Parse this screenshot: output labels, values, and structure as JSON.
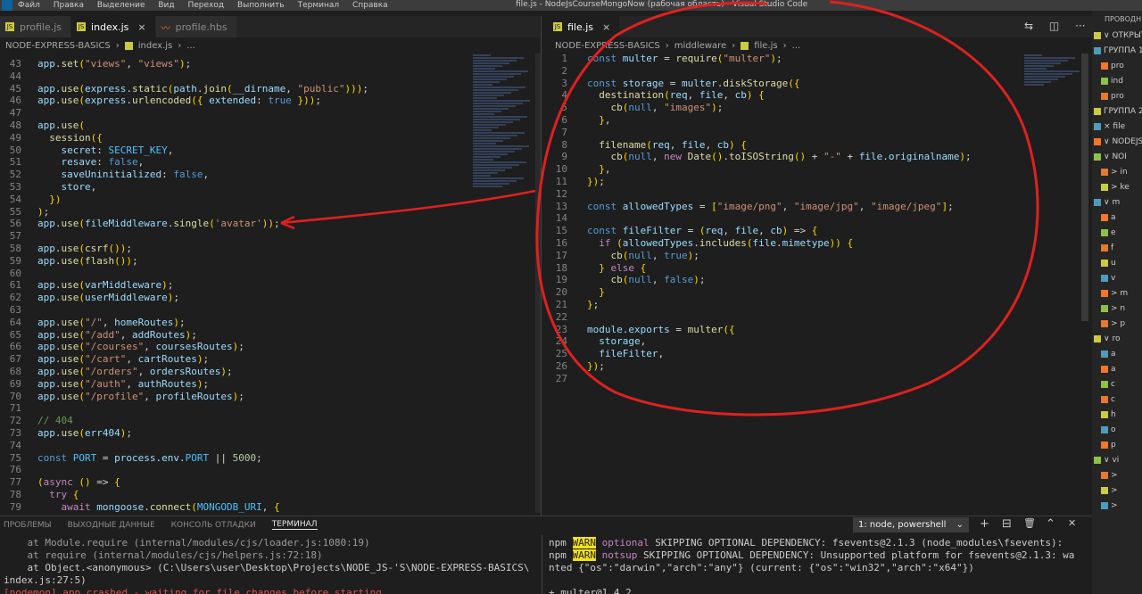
{
  "titlebar": {
    "menu": [
      "Файл",
      "Правка",
      "Выделение",
      "Вид",
      "Переход",
      "Выполнить",
      "Терминал",
      "Справка"
    ],
    "title": "file.js - NodeJsCourseMongoNow (рабочая область) - Visual Studio Code"
  },
  "left_tabs": [
    {
      "label": "profile.js",
      "icon": "js-icon"
    },
    {
      "label": "index.js",
      "icon": "js-icon",
      "close": "×"
    },
    {
      "label": "profile.hbs",
      "icon": "hbs-icon"
    }
  ],
  "right_tabs": [
    {
      "label": "file.js",
      "icon": "js-icon",
      "close": "×"
    }
  ],
  "left_breadcrumb": [
    "NODE-EXPRESS-BASICS",
    "›",
    "index.js",
    "›",
    "..."
  ],
  "right_breadcrumb": [
    "NODE-EXPRESS-BASICS",
    "›",
    "middleware",
    "›",
    "file.js",
    "›",
    "..."
  ],
  "left_editor": {
    "line_numbers": [
      "43",
      "44",
      "45",
      "46",
      "47",
      "48",
      "49",
      "50",
      "51",
      "52",
      "53",
      "54",
      "55",
      "56",
      "57",
      "58",
      "59",
      "60",
      "61",
      "62",
      "63",
      "64",
      "65",
      "66",
      "67",
      "68",
      "69",
      "70",
      "71",
      "72",
      "73",
      "74",
      "75",
      "76",
      "77",
      "78",
      "79"
    ],
    "lines": [
      "app.set(\"views\", \"views\");",
      "",
      "app.use(express.static(path.join(__dirname, \"public\")));",
      "app.use(express.urlencoded({ extended: true }));",
      "",
      "app.use(",
      "  session({",
      "    secret: SECRET_KEY,",
      "    resave: false,",
      "    saveUninitialized: false,",
      "    store,",
      "  })",
      ");",
      "app.use(fileMiddleware.single('avatar'));",
      "",
      "app.use(csrf());",
      "app.use(flash());",
      "",
      "app.use(varMiddleware);",
      "app.use(userMiddleware);",
      "",
      "app.use(\"/\", homeRoutes);",
      "app.use(\"/add\", addRoutes);",
      "app.use(\"/courses\", coursesRoutes);",
      "app.use(\"/cart\", cartRoutes);",
      "app.use(\"/orders\", ordersRoutes);",
      "app.use(\"/auth\", authRoutes);",
      "app.use(\"/profile\", profileRoutes);",
      "",
      "// 404",
      "app.use(err404);",
      "",
      "const PORT = process.env.PORT || 5000;",
      "",
      "(async () => {",
      "  try {",
      "    await mongoose.connect(MONGODB_URI, {"
    ]
  },
  "right_editor": {
    "line_numbers": [
      "1",
      "2",
      "3",
      "4",
      "5",
      "6",
      "7",
      "8",
      "9",
      "10",
      "11",
      "12",
      "13",
      "14",
      "15",
      "16",
      "17",
      "18",
      "19",
      "20",
      "21",
      "22",
      "23",
      "24",
      "25",
      "26",
      "27"
    ],
    "lines": [
      "const multer = require(\"multer\");",
      "",
      "const storage = multer.diskStorage({",
      "  destination(req, file, cb) {",
      "    cb(null, \"images\");",
      "  },",
      "",
      "  filename(req, file, cb) {",
      "    cb(null, new Date().toISOString() + \"-\" + file.originalname);",
      "  },",
      "});",
      "",
      "const allowedTypes = [\"image/png\", \"image/jpg\", \"image/jpeg\"];",
      "",
      "const fileFilter = (req, file, cb) => {",
      "  if (allowedTypes.includes(file.mimetype)) {",
      "    cb(null, true);",
      "  } else {",
      "    cb(null, false);",
      "  }",
      "};",
      "",
      "module.exports = multer({",
      "  storage,",
      "  fileFilter,",
      "});",
      ""
    ]
  },
  "panel": {
    "tabs": [
      "ПРОБЛЕМЫ",
      "ВЫХОДНЫЕ ДАННЫЕ",
      "КОНСОЛЬ ОТЛАДКИ",
      "ТЕРМИНАЛ"
    ],
    "active_tab": "ТЕРМИНАЛ",
    "terminal_select": "1: node, powershell",
    "tools": [
      "+",
      "⊟",
      "🗑",
      "⌃",
      "✕"
    ]
  },
  "terminal_left": [
    "    at Module.require (internal/modules/cjs/loader.js:1080:19)",
    "    at require (internal/modules/cjs/helpers.js:72:18)",
    "    at Object.<anonymous> (C:\\Users\\user\\Desktop\\Projects\\NODE_JS-'S\\NODE-EXPRESS-BASICS\\",
    "index.js:27:5)",
    "[nodemon] app crashed - waiting for file changes before starting..."
  ],
  "terminal_right": {
    "line1_prefix": "npm ",
    "line1_warn": "WARN",
    "line1_kind": " optional",
    "line1_text": " SKIPPING OPTIONAL DEPENDENCY: fsevents@2.1.3 (node_modules\\fsevents):",
    "line2_prefix": "npm ",
    "line2_warn": "WARN",
    "line2_kind": " notsup",
    "line2_text": " SKIPPING OPTIONAL DEPENDENCY: Unsupported platform for fsevents@2.1.3: wa",
    "line3": "nted {\"os\":\"darwin\",\"arch\":\"any\"} (current: {\"os\":\"win32\",\"arch\":\"x64\"})",
    "line4": "",
    "line5": "+ multer@1.4.2"
  },
  "explorer": {
    "header": "ПРОВОДНИК",
    "rows": [
      "∨ ОТКРЫТЫ",
      "ГРУППА 1",
      "pro",
      "ind",
      "pro",
      "ГРУППА 2",
      "× file",
      "∨ NODEJSCO",
      "∨ NOI",
      "> in",
      "> ke",
      "∨ m",
      "a",
      "e",
      "f",
      "u",
      "v",
      "> m",
      "> n",
      "> p",
      "∨ ro",
      "a",
      "a",
      "c",
      "c",
      "h",
      "o",
      "p",
      "∨ vi",
      "> ",
      "> ",
      "> "
    ]
  },
  "colors": {
    "annotation": "#e02020",
    "accent": "#0e639c",
    "warn": "#f2e01c"
  }
}
